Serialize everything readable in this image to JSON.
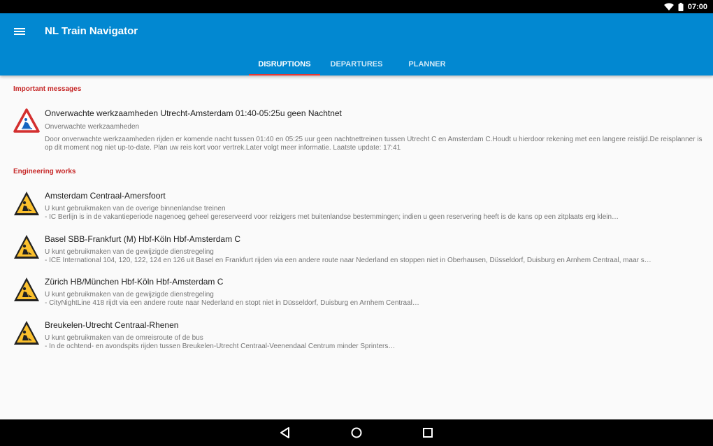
{
  "status_bar": {
    "time": "07:00",
    "icons": [
      "wifi-icon",
      "battery-icon"
    ]
  },
  "app_bar": {
    "title": "NL Train Navigator",
    "menu_icon": "hamburger-menu-icon"
  },
  "tabs": [
    {
      "label": "DISRUPTIONS",
      "active": true
    },
    {
      "label": "DEPARTURES",
      "active": false
    },
    {
      "label": "PLANNER",
      "active": false
    }
  ],
  "sections": [
    {
      "header": "Important messages",
      "items": [
        {
          "icon": "warning-red-triangle-icon",
          "title": "Onverwachte werkzaamheden Utrecht-Amsterdam 01:40-05:25u geen Nachtnet",
          "subtitle": "Onverwachte werkzaamheden",
          "description": "Door onverwachte werkzaamheden rijden er komende nacht tussen 01:40 en 05:25 uur geen nachtnettreinen tussen Utrecht C en Amsterdam C.Houdt u hierdoor rekening met een langere reistijd.De reisplanner is op dit moment nog niet up-to-date. Plan uw reis kort voor vertrek.Later volgt meer informatie. Laatste update: 17:41"
        }
      ]
    },
    {
      "header": "Engineering works",
      "items": [
        {
          "icon": "roadwork-sign-icon",
          "title": "Amsterdam Centraal-Amersfoort",
          "subtitle": "U kunt gebruikmaken van de overige binnenlandse treinen",
          "description": "- IC Berlijn is in de vakantieperiode nagenoeg geheel gereserveerd voor reizigers met buitenlandse bestemmingen; indien u geen reservering heeft is de kans op een zitplaats erg klein…"
        },
        {
          "icon": "roadwork-sign-icon",
          "title": "Basel SBB-Frankfurt (M) Hbf-Köln Hbf-Amsterdam C",
          "subtitle": "U kunt gebruikmaken van de gewijzigde dienstregeling",
          "description": "- ICE International 104, 120, 122, 124 en 126 uit Basel en Frankfurt rijden via een andere route naar Nederland en stoppen niet in Oberhausen, Düsseldorf, Duisburg en Arnhem Centraal, maar s…"
        },
        {
          "icon": "roadwork-sign-icon",
          "title": "Zürich HB/München Hbf-Köln Hbf-Amsterdam C",
          "subtitle": "U kunt gebruikmaken van de gewijzigde dienstregeling",
          "description": "- CityNightLine 418 rijdt via een andere route naar Nederland en stopt niet in Düsseldorf, Duisburg en Arnhem Centraal…"
        },
        {
          "icon": "roadwork-sign-icon",
          "title": "Breukelen-Utrecht Centraal-Rhenen",
          "subtitle": "U kunt gebruikmaken van de omreisroute of de bus",
          "description": "- In de ochtend- en avondspits rijden tussen Breukelen-Utrecht Centraal-Veenendaal Centrum minder Sprinters…"
        }
      ]
    }
  ],
  "nav_bar": {
    "buttons": [
      "back-icon",
      "home-icon",
      "recents-icon"
    ]
  },
  "colors": {
    "app_bar": "#0288d1",
    "tab_indicator": "#e53935",
    "section_header": "#c62828",
    "warning_red": "#d32f2f",
    "roadwork_yellow": "#fbc02d"
  }
}
